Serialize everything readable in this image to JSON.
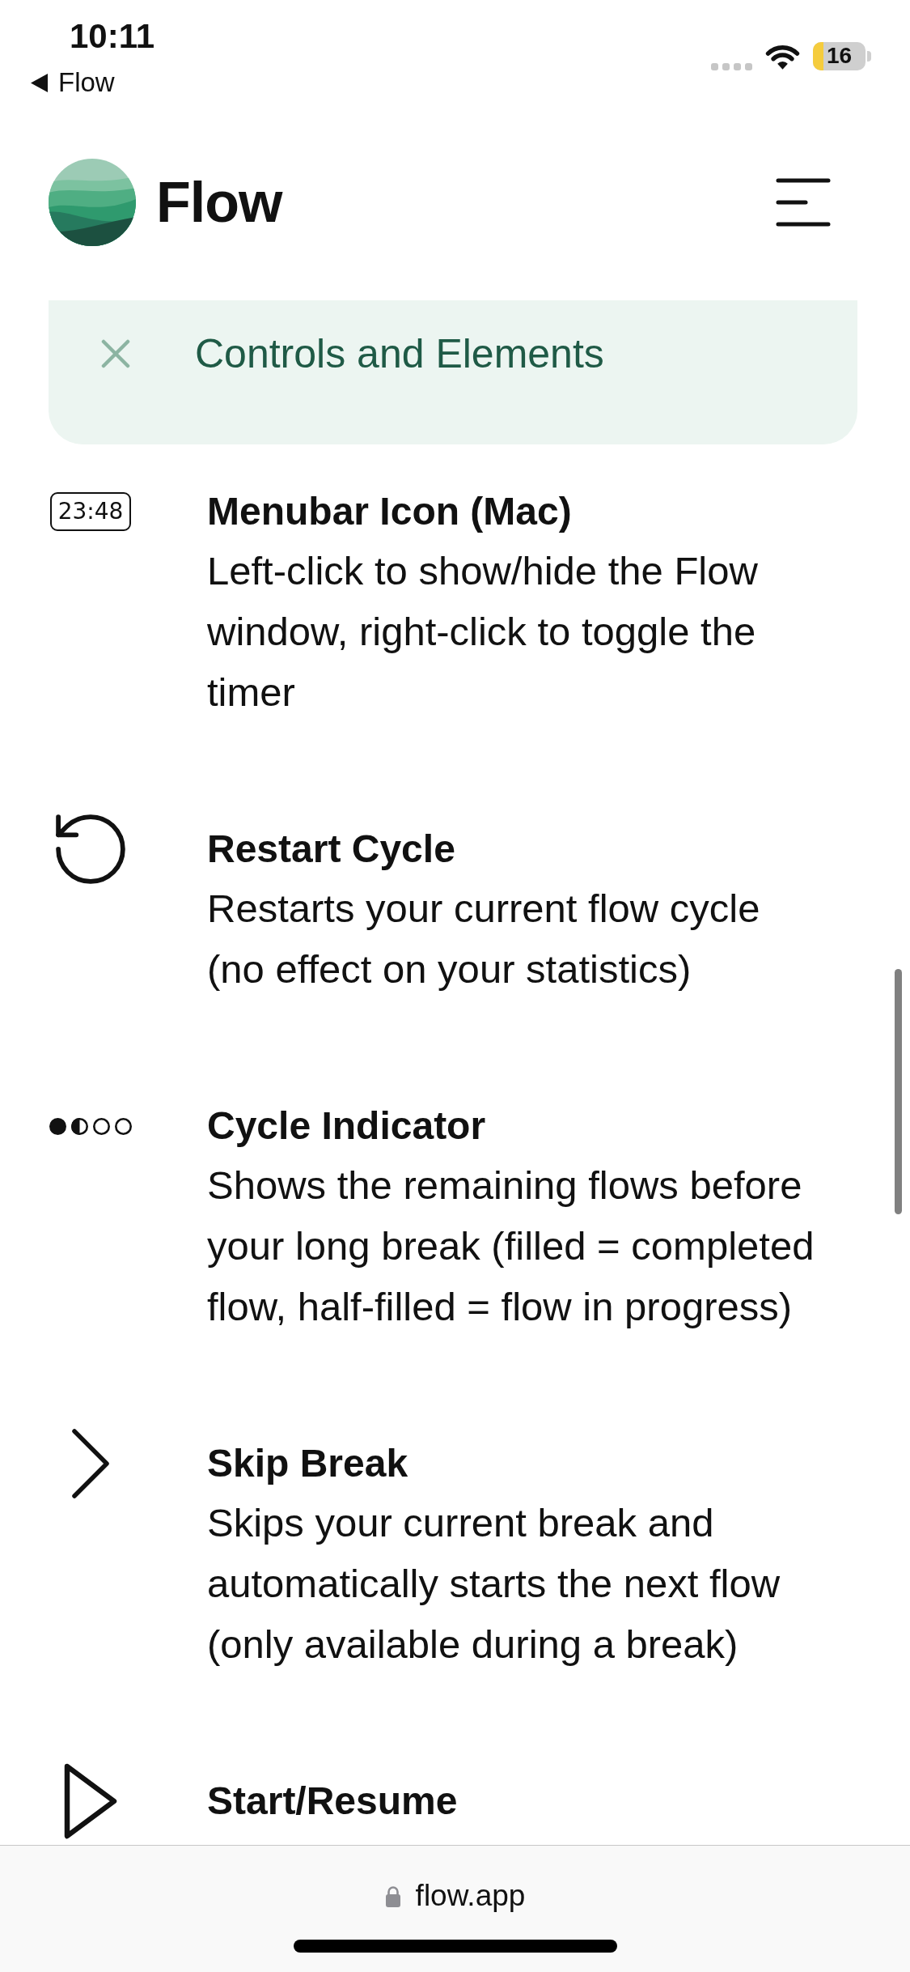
{
  "status_bar": {
    "time": "10:11",
    "back_link": "Flow",
    "battery": {
      "text": "16",
      "low_power_mode": true
    }
  },
  "header": {
    "brand": "Flow"
  },
  "section": {
    "title": "Controls and Elements",
    "expanded": true
  },
  "items": [
    {
      "title": "Menubar Icon (Mac)",
      "description": "Left-click to show/hide the Flow window, right-click to toggle the timer",
      "icon": {
        "kind": "timer",
        "text": "23:48"
      }
    },
    {
      "title": "Restart Cycle",
      "description": "Restarts your current flow cycle (no effect on your statistics)",
      "icon": {
        "kind": "restart"
      }
    },
    {
      "title": "Cycle Indicator",
      "description": "Shows the remaining flows before your long break (filled = completed flow, half-filled = flow in progress)",
      "icon": {
        "kind": "cycle",
        "dots": [
          {
            "kind": "filled"
          },
          {
            "kind": "half"
          },
          {
            "kind": "empty"
          },
          {
            "kind": "empty"
          }
        ]
      }
    },
    {
      "title": "Skip Break",
      "description": "Skips your current break and automatically starts the next flow (only available during a break)",
      "icon": {
        "kind": "skip"
      }
    },
    {
      "title": "Start/Resume",
      "icon": {
        "kind": "play"
      }
    }
  ],
  "browser_bar": {
    "url": "flow.app"
  }
}
